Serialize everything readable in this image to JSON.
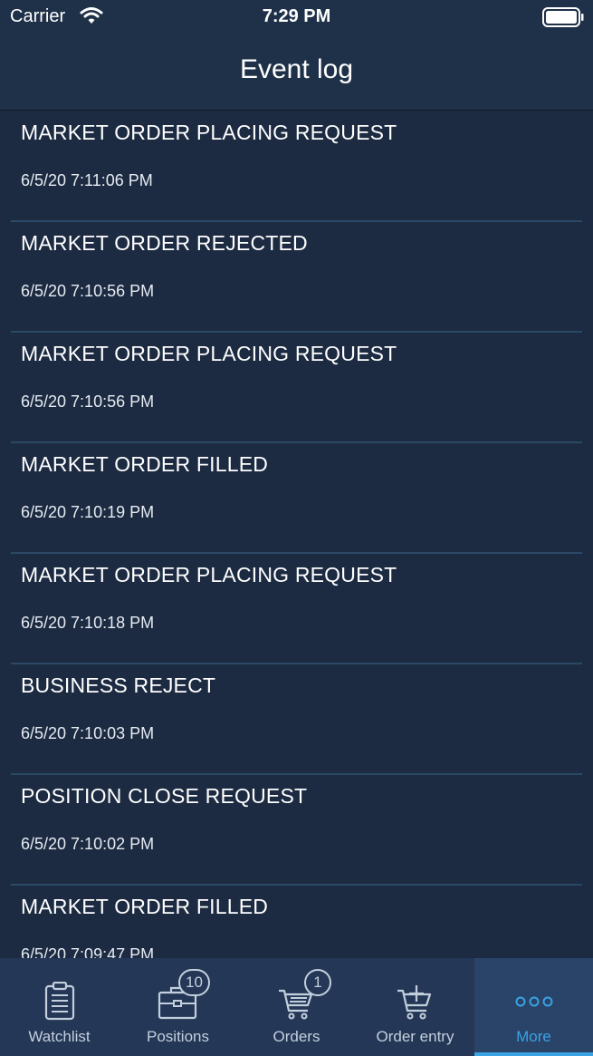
{
  "status_bar": {
    "carrier": "Carrier",
    "time": "7:29 PM",
    "wifi_icon": "wifi-icon",
    "battery_icon": "battery-icon"
  },
  "nav": {
    "title": "Event log"
  },
  "events": [
    {
      "title": "MARKET ORDER PLACING REQUEST",
      "time": "6/5/20 7:11:06 PM"
    },
    {
      "title": "MARKET ORDER REJECTED",
      "time": "6/5/20 7:10:56 PM"
    },
    {
      "title": "MARKET ORDER PLACING REQUEST",
      "time": "6/5/20 7:10:56 PM"
    },
    {
      "title": "MARKET ORDER FILLED",
      "time": "6/5/20 7:10:19 PM"
    },
    {
      "title": "MARKET ORDER PLACING REQUEST",
      "time": "6/5/20 7:10:18 PM"
    },
    {
      "title": "BUSINESS REJECT",
      "time": "6/5/20 7:10:03 PM"
    },
    {
      "title": "POSITION CLOSE REQUEST",
      "time": "6/5/20 7:10:02 PM"
    },
    {
      "title": "MARKET ORDER FILLED",
      "time": "6/5/20 7:09:47 PM"
    }
  ],
  "tabs": [
    {
      "label": "Watchlist",
      "icon": "clipboard-icon",
      "badge": null,
      "active": false
    },
    {
      "label": "Positions",
      "icon": "briefcase-icon",
      "badge": "10",
      "active": false
    },
    {
      "label": "Orders",
      "icon": "cart-icon",
      "badge": "1",
      "active": false
    },
    {
      "label": "Order entry",
      "icon": "cart-add-icon",
      "badge": null,
      "active": false
    },
    {
      "label": "More",
      "icon": "more-icon",
      "badge": null,
      "active": true
    }
  ],
  "colors": {
    "background": "#1c2b42",
    "accent": "#3aa3e3",
    "tab_inactive": "#c3cfdd"
  }
}
